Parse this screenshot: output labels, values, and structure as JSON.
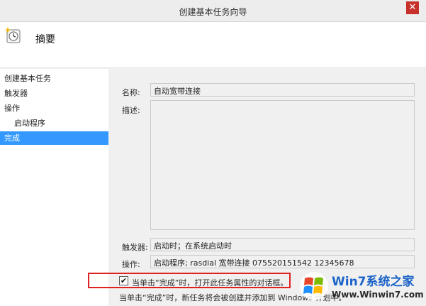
{
  "window": {
    "title": "创建基本任务向导",
    "close_glyph": "✕"
  },
  "header": {
    "title": "摘要",
    "icon": "task-clock-icon"
  },
  "sidebar": {
    "items": [
      {
        "label": "创建基本任务"
      },
      {
        "label": "触发器"
      },
      {
        "label": "操作"
      },
      {
        "label": "启动程序"
      },
      {
        "label": "完成"
      }
    ]
  },
  "form": {
    "name_label": "名称:",
    "name_value": "自动宽带连接",
    "desc_label": "描述:",
    "desc_value": "",
    "trigger_label": "触发器:",
    "trigger_value": "启动时；在系统启动时",
    "action_label": "操作:",
    "action_value": "启动程序; rasdial 宽带连接 075520151542 12345678",
    "checkbox_checked": true,
    "checkbox_glyph": "✔",
    "checkbox_label": "当单击“完成”时，打开此任务属性的对话框。",
    "note": "当单击“完成”时，新任务将会被创建并添加到 Windows 计划中。"
  },
  "watermark": {
    "title": "Win7系统之家",
    "url": "Www.Winwin7.com"
  },
  "colors": {
    "accent": "#3399ff",
    "highlight": "#dd2222",
    "close": "#c7302b"
  }
}
